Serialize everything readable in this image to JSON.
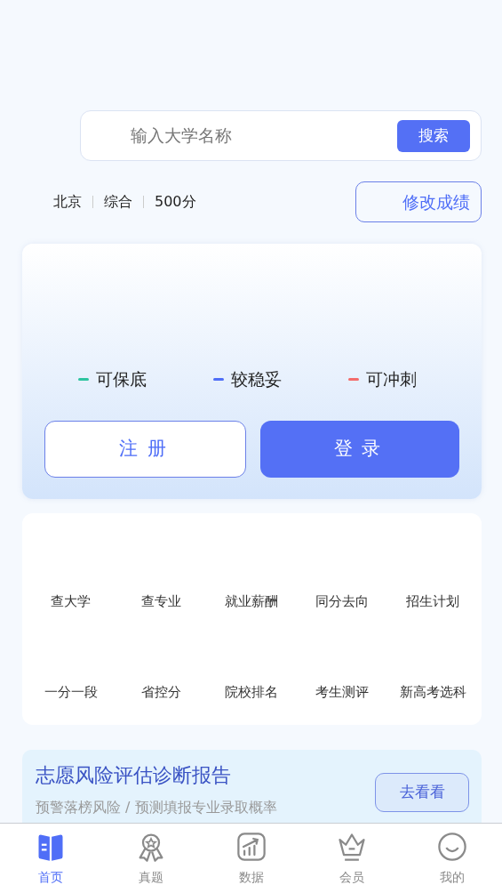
{
  "search": {
    "placeholder": "输入大学名称",
    "button": "搜索"
  },
  "profile": {
    "items": [
      "北京",
      "综合",
      "500分"
    ],
    "edit_button": "修改成绩"
  },
  "risk_legend": [
    {
      "label": "可保底",
      "color": "#2ec4a0"
    },
    {
      "label": "较稳妥",
      "color": "#4f6ef7"
    },
    {
      "label": "可冲刺",
      "color": "#f36b6b"
    }
  ],
  "auth_buttons": [
    {
      "label": "注册",
      "kind": "outline"
    },
    {
      "label": "登录",
      "kind": "filled"
    }
  ],
  "tools": [
    "查大学",
    "查专业",
    "就业薪酬",
    "同分去向",
    "招生计划",
    "一分一段",
    "省控分",
    "院校排名",
    "考生测评",
    "新高考选科"
  ],
  "banner": {
    "title": "志愿风险评估诊断报告",
    "subtitle": "预警落榜风险 / 预测填报专业录取概率",
    "button": "去看看"
  },
  "tabs": [
    {
      "label": "首页",
      "selected": true
    },
    {
      "label": "真题",
      "selected": false
    },
    {
      "label": "数据",
      "selected": false
    },
    {
      "label": "会员",
      "selected": false
    },
    {
      "label": "我的",
      "selected": false
    }
  ]
}
